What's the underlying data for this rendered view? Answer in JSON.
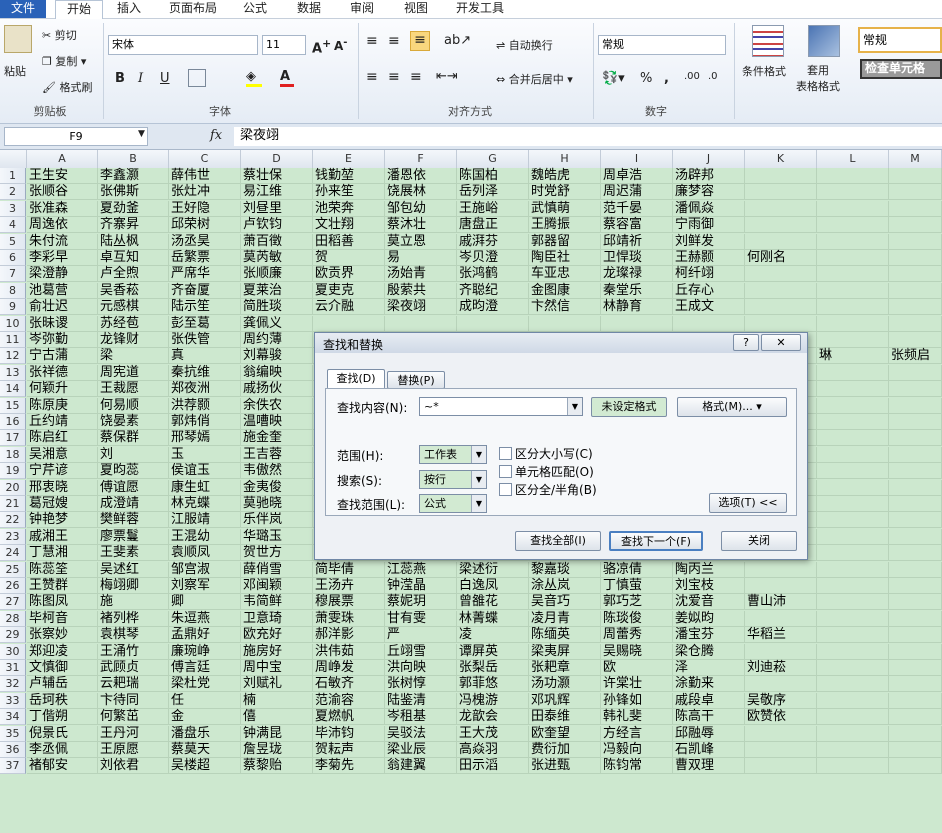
{
  "tabs": [
    "文件",
    "开始",
    "插入",
    "页面布局",
    "公式",
    "数据",
    "审阅",
    "视图",
    "开发工具"
  ],
  "clipboard": {
    "paste": "粘贴",
    "cut": "剪切",
    "copy": "复制",
    "format_painter": "格式刷",
    "group": "剪贴板"
  },
  "font": {
    "name": "宋体",
    "size": "11",
    "group": "字体"
  },
  "alignment": {
    "wrap": "自动换行",
    "merge": "合并后居中",
    "group": "对齐方式"
  },
  "number": {
    "format": "常规",
    "group": "数字"
  },
  "styles": {
    "conditional": "条件格式",
    "table_format": "套用\n表格格式",
    "style_normal": "常规",
    "style_check": "检查单元格"
  },
  "formula_bar": {
    "name_box": "F9",
    "fx": "fx",
    "value": "梁夜翊"
  },
  "columns": [
    "A",
    "B",
    "C",
    "D",
    "E",
    "F",
    "G",
    "H",
    "I",
    "J",
    "K",
    "L",
    "M"
  ],
  "rows": [
    {
      "n": "1",
      "cells": [
        "王生安",
        "李鑫灏",
        "薛伟世",
        "蔡壮保",
        "钱勤堃",
        "潘恩依",
        "陈国柏",
        "魏皓虎",
        "周卓浩",
        "汤辟邦",
        "",
        "",
        ""
      ]
    },
    {
      "n": "2",
      "cells": [
        "张顺谷",
        "张佛斯",
        "张灶冲",
        "易江维",
        "孙来笙",
        "饶展林",
        "岳列泽",
        "时党舒",
        "周迟蒲",
        "廉梦容",
        "",
        "",
        ""
      ]
    },
    {
      "n": "3",
      "cells": [
        "张准森",
        "夏劲釜",
        "王好隐",
        "刘昼里",
        "池荣奔",
        "邹包幼",
        "王施峪",
        "武慎萌",
        "范千晏",
        "潘佩焱",
        "",
        "",
        ""
      ]
    },
    {
      "n": "4",
      "cells": [
        "周逸依",
        "齐寨昇",
        "邱荣树",
        "卢钦钧",
        "文壮翔",
        "蔡沐壮",
        "唐盘正",
        "王腾振",
        "蔡容富",
        "宁雨御",
        "",
        "",
        ""
      ]
    },
    {
      "n": "5",
      "cells": [
        "朱付流",
        "陆丛枫",
        "汤丞昊",
        "萧百徵",
        "田稻善",
        "莫立恩",
        "戚湃芬",
        "郭器留",
        "邱靖祈",
        "刘鲜发",
        "",
        "",
        ""
      ]
    },
    {
      "n": "6",
      "cells": [
        "李彩早",
        "卓互知",
        "岳繁票",
        "莫芮敏",
        "贺",
        "易",
        "岑贝澄",
        "陶臣社",
        "卫悍琰",
        "王赫颢",
        "何刚名",
        "",
        ""
      ]
    },
    {
      "n": "7",
      "cells": [
        "梁澄静",
        "卢全煦",
        "严席华",
        "张顺廉",
        "欧贡界",
        "汤始青",
        "张鸿鹤",
        "车亚忠",
        "龙璨禄",
        "柯纤翊",
        "",
        "",
        ""
      ]
    },
    {
      "n": "8",
      "cells": [
        "池葛营",
        "吴香菘",
        "齐奋厦",
        "夏莱治",
        "夏吏克",
        "殷萦共",
        "齐聪纪",
        "金图康",
        "秦堂乐",
        "丘存心",
        "",
        "",
        ""
      ]
    },
    {
      "n": "9",
      "cells": [
        "俞壮迟",
        "元感棋",
        "陆示笙",
        "简胜琰",
        "云介融",
        "梁夜翊",
        "成昀澄",
        "卞然信",
        "林静育",
        "王成文",
        "",
        "",
        ""
      ]
    },
    {
      "n": "10",
      "cells": [
        "张昧谡",
        "苏经苞",
        "彭至葛",
        "龚佩义",
        "",
        "",
        "",
        "",
        "",
        "",
        "",
        "",
        ""
      ]
    },
    {
      "n": "11",
      "cells": [
        "岑弥勤",
        "龙锋财",
        "张佚管",
        "周约薄",
        "",
        "",
        "",
        "",
        "",
        "",
        "",
        "",
        ""
      ]
    },
    {
      "n": "12",
      "cells": [
        "宁古蒲",
        "梁",
        "真",
        "刘幕骏",
        "",
        "",
        "",
        "",
        "",
        "",
        "",
        "琳",
        "张频启"
      ]
    },
    {
      "n": "13",
      "cells": [
        "张祥德",
        "周宪道",
        "秦抗维",
        "翁编映",
        "",
        "",
        "",
        "",
        "",
        "",
        "",
        "",
        ""
      ]
    },
    {
      "n": "14",
      "cells": [
        "何颖升",
        "王裁愿",
        "郑夜洲",
        "戚扬伙",
        "",
        "",
        "",
        "",
        "",
        "",
        "",
        "",
        ""
      ]
    },
    {
      "n": "15",
      "cells": [
        "陈原庚",
        "何易顺",
        "洪荐颢",
        "余佚农",
        "",
        "",
        "",
        "",
        "",
        "",
        "",
        "",
        ""
      ]
    },
    {
      "n": "16",
      "cells": [
        "丘约靖",
        "饶晏素",
        "郭炜俏",
        "温嘈映",
        "",
        "",
        "",
        "",
        "",
        "",
        "",
        "",
        ""
      ]
    },
    {
      "n": "17",
      "cells": [
        "陈启红",
        "蔡保群",
        "邢琴嫣",
        "施金奎",
        "",
        "",
        "",
        "",
        "",
        "",
        "",
        "",
        ""
      ]
    },
    {
      "n": "18",
      "cells": [
        "吴湘意",
        "刘",
        "玉",
        "王吉蓉",
        "",
        "",
        "",
        "",
        "",
        "",
        "",
        "",
        ""
      ]
    },
    {
      "n": "19",
      "cells": [
        "宁芹谚",
        "夏昀蕊",
        "侯谊玉",
        "韦傲然",
        "",
        "",
        "",
        "",
        "",
        "",
        "",
        "",
        ""
      ]
    },
    {
      "n": "20",
      "cells": [
        "邢衷晓",
        "傅谊愿",
        "康生虹",
        "金夷俊",
        "",
        "",
        "",
        "",
        "",
        "",
        "",
        "",
        ""
      ]
    },
    {
      "n": "21",
      "cells": [
        "葛冠嫂",
        "成澄靖",
        "林克蝶",
        "莫驰晓",
        "",
        "",
        "",
        "",
        "",
        "",
        "",
        "",
        ""
      ]
    },
    {
      "n": "22",
      "cells": [
        "钟艳梦",
        "樊鲜蓉",
        "江服靖",
        "乐伴岚",
        "",
        "",
        "",
        "",
        "",
        "",
        "",
        "",
        ""
      ]
    },
    {
      "n": "23",
      "cells": [
        "戚湘王",
        "廖票鬘",
        "王混幼",
        "华璐玉",
        "云馨姐",
        "鲁中碧",
        "巫慕红",
        "陈蕴艺",
        "廖霖芝",
        "葛璇谰",
        "",
        "",
        ""
      ]
    },
    {
      "n": "24",
      "cells": [
        "丁慧湘",
        "王斐素",
        "袁顺凤",
        "贺世方",
        "张蕊玉",
        "周阳豫",
        "梁示巧",
        "周谏谚",
        "袁当艺",
        "倪馨琴",
        "",
        "",
        ""
      ]
    },
    {
      "n": "25",
      "cells": [
        "陈蕊筌",
        "吴述红",
        "邹宫淑",
        "薛俏雪",
        "简毕倩",
        "江蕊燕",
        "梁述衍",
        "黎嘉琰",
        "骆凉倩",
        "陶丙兰",
        "",
        "",
        ""
      ]
    },
    {
      "n": "26",
      "cells": [
        "王赞群",
        "梅翊卿",
        "刘察军",
        "邓闽颖",
        "王汤卉",
        "钟滢晶",
        "白逸凤",
        "涂丛岚",
        "丁慎萤",
        "刘宝枝",
        "",
        "",
        ""
      ]
    },
    {
      "n": "27",
      "cells": [
        "陈图凤",
        "施",
        "卿",
        "韦简鲜",
        "穆展票",
        "蔡妮玥",
        "曾雒花",
        "吴音巧",
        "郭巧芝",
        "沈爱音",
        "曹山沛",
        "",
        ""
      ]
    },
    {
      "n": "28",
      "cells": [
        "毕柯音",
        "褚列桦",
        "朱逗燕",
        "卫意琦",
        "萧雯珠",
        "甘有雯",
        "林菁蝶",
        "凌月青",
        "陈琰俊",
        "姜姒昀",
        "",
        "",
        ""
      ]
    },
    {
      "n": "29",
      "cells": [
        "张察妙",
        "袁棋琴",
        "孟鼎好",
        "欧充好",
        "郝洋影",
        "严",
        "凌",
        "陈缅英",
        "周蕾秀",
        "潘宝芬",
        "华稻兰",
        "",
        ""
      ]
    },
    {
      "n": "30",
      "cells": [
        "郑迎凌",
        "王涌竹",
        "廉琬峥",
        "施房好",
        "洪伟茹",
        "丘翊雪",
        "谭屏英",
        "梁夷屏",
        "吴赐晓",
        "梁仓腾",
        "",
        "",
        ""
      ]
    },
    {
      "n": "31",
      "cells": [
        "文慎御",
        "武顾贞",
        "傅言廷",
        "周中宝",
        "周峥发",
        "洪向映",
        "张梨岳",
        "张耙章",
        "欧",
        "泽",
        "刘迪菘",
        "",
        ""
      ]
    },
    {
      "n": "32",
      "cells": [
        "卢辅岳",
        "云耙瑞",
        "梁杜党",
        "刘赋礼",
        "石敏齐",
        "张树惇",
        "郭菲悠",
        "汤功灏",
        "许棠壮",
        "涂勤来",
        "",
        "",
        ""
      ]
    },
    {
      "n": "33",
      "cells": [
        "岳珂秩",
        "卞待同",
        "任",
        "楠",
        "范渝容",
        "陆鉴清",
        "冯槐游",
        "邓巩辉",
        "孙锋如",
        "戚段卓",
        "吴敬序",
        "",
        ""
      ]
    },
    {
      "n": "34",
      "cells": [
        "丁偕朔",
        "何繁茁",
        "金",
        "僖",
        "夏燃帆",
        "岑租基",
        "龙歆会",
        "田泰维",
        "韩礼斐",
        "陈高干",
        "欧赞依",
        "",
        ""
      ]
    },
    {
      "n": "35",
      "cells": [
        "倪景氏",
        "王丹河",
        "潘盘乐",
        "钟满昆",
        "毕沛钧",
        "吴驳法",
        "王大茂",
        "欧奎望",
        "方经言",
        "邱融辱",
        "",
        "",
        ""
      ]
    },
    {
      "n": "36",
      "cells": [
        "李丞佩",
        "王原愿",
        "蔡莫天",
        "詹昱珑",
        "贺耘声",
        "梁业辰",
        "高焱羽",
        "费衍加",
        "冯毅向",
        "石凯峰",
        "",
        "",
        ""
      ]
    },
    {
      "n": "37",
      "cells": [
        "褚郁安",
        "刘依君",
        "吴楼超",
        "蔡黎贻",
        "李菊先",
        "翁建翼",
        "田示滔",
        "张进甄",
        "陈钧常",
        "曹双理",
        "",
        "",
        ""
      ]
    }
  ],
  "dialog": {
    "title": "查找和替换",
    "help": "?",
    "tabs": [
      "查找(D)",
      "替换(P)"
    ],
    "find_label": "查找内容(N):",
    "find_value": "~*",
    "no_format": "未设定格式",
    "format_btn": "格式(M)...",
    "scope_label": "范围(H):",
    "scope_value": "工作表",
    "search_label": "搜索(S):",
    "search_value": "按行",
    "lookin_label": "查找范围(L):",
    "lookin_value": "公式",
    "match_case": "区分大小写(C)",
    "match_cell": "单元格匹配(O)",
    "match_byte": "区分全/半角(B)",
    "options_btn": "选项(T) <<",
    "find_all": "查找全部(I)",
    "find_next": "查找下一个(F)",
    "close": "关闭"
  }
}
